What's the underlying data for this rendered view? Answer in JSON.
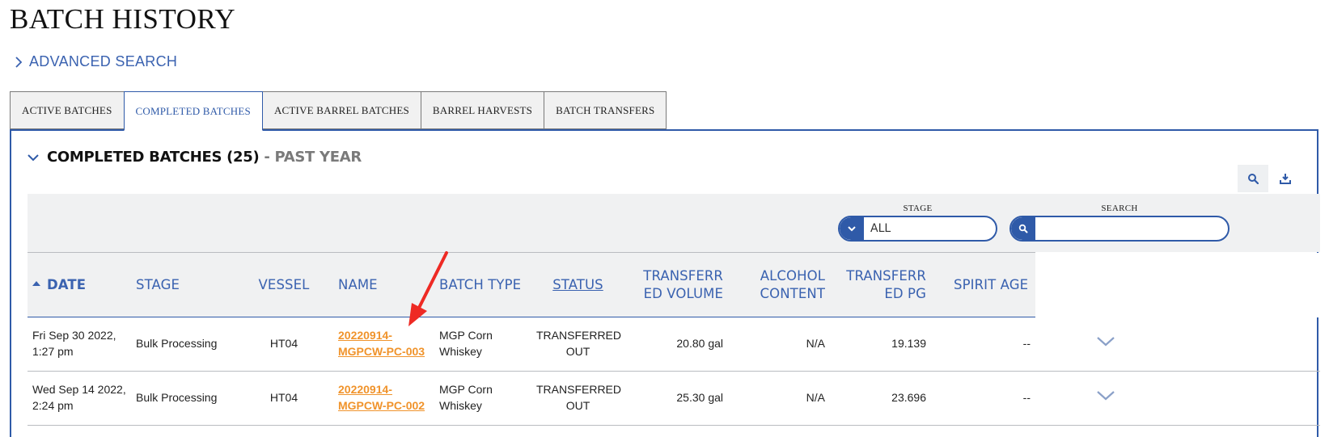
{
  "page": {
    "title": "BATCH HISTORY"
  },
  "advanced_search": {
    "label": "ADVANCED SEARCH"
  },
  "tabs": [
    {
      "label": "ACTIVE BATCHES",
      "active": false
    },
    {
      "label": "COMPLETED BATCHES",
      "active": true
    },
    {
      "label": "ACTIVE BARREL BATCHES",
      "active": false
    },
    {
      "label": "BARREL HARVESTS",
      "active": false
    },
    {
      "label": "BATCH TRANSFERS",
      "active": false
    }
  ],
  "section": {
    "title": "COMPLETED BATCHES (25)",
    "subtitle": " - PAST YEAR"
  },
  "filters": {
    "stage": {
      "label": "STAGE",
      "value": "ALL"
    },
    "search": {
      "label": "SEARCH",
      "placeholder": ""
    }
  },
  "table": {
    "columns": [
      {
        "label": "DATE"
      },
      {
        "label": "STAGE"
      },
      {
        "label": "VESSEL"
      },
      {
        "label": "NAME"
      },
      {
        "label": "BATCH TYPE"
      },
      {
        "label": "STATUS"
      },
      {
        "label": "TRANSFERR ED VOLUME"
      },
      {
        "label": "ALCOHOL CONTENT"
      },
      {
        "label": "TRANSFERR ED PG"
      },
      {
        "label": "SPIRIT AGE"
      }
    ],
    "rows": [
      {
        "date": "Fri Sep 30 2022, 1:27 pm",
        "stage": "Bulk Processing",
        "vessel": "HT04",
        "name": "20220914-MGPCW-PC-003",
        "batch_type": "MGP Corn Whiskey",
        "status": "TRANSFERRED OUT",
        "transferred_volume": "20.80 gal",
        "alcohol_content": "N/A",
        "transferred_pg": "19.139",
        "spirit_age": "--"
      },
      {
        "date": "Wed Sep 14 2022, 2:24 pm",
        "stage": "Bulk Processing",
        "vessel": "HT04",
        "name": "20220914-MGPCW-PC-002",
        "batch_type": "MGP Corn Whiskey",
        "status": "TRANSFERRED OUT",
        "transferred_volume": "25.30 gal",
        "alcohol_content": "N/A",
        "transferred_pg": "23.696",
        "spirit_age": "--"
      }
    ]
  },
  "colors": {
    "accent": "#2f5aa8",
    "link": "#f0932b",
    "annotation": "#ee2a24"
  },
  "icons": [
    "chevron-right-icon",
    "chevron-down-icon",
    "search-icon",
    "download-icon",
    "expand-chevron-icon",
    "sort-up-icon"
  ]
}
